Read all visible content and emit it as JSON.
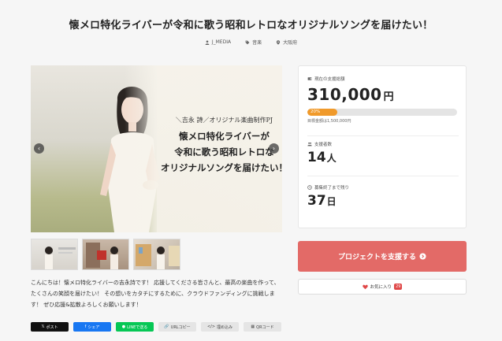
{
  "project": {
    "title": "懐メロ特化ライバーが令和に歌う昭和レトロなオリジナルソングを届けたい！",
    "meta": [
      {
        "icon": "user-icon",
        "text": "J_MEDIA"
      },
      {
        "icon": "tag-icon",
        "text": "音楽"
      },
      {
        "icon": "location-icon",
        "text": "大阪府"
      }
    ]
  },
  "hero": {
    "caption_sub": "＼吉永 詩／オリジナル楽曲制作PJ",
    "caption_lines": [
      "懐メロ特化ライバーが",
      "令和に歌う昭和レトロな",
      "オリジナルソングを届けたい！"
    ],
    "prev_arrow": "‹",
    "next_arrow": "›"
  },
  "description": "こんにちは！懐メロ特化ライバーの吉永詩です！ 応援してくださる皆さんと、最高の楽曲を作って、たくさんの笑顔を届けたい！ その想いをカタチにするために、クラウドファンディングに挑戦します！ ぜひ応援&拡散よろしくお願いします！",
  "share": [
    {
      "name": "x-post",
      "label": "ポスト",
      "icon": "𝕏"
    },
    {
      "name": "facebook-share",
      "label": "シェア",
      "icon": "f"
    },
    {
      "name": "line-send",
      "label": "LINEで送る",
      "icon": "●"
    },
    {
      "name": "url-copy",
      "label": "URLコピー",
      "icon": "🔗"
    },
    {
      "name": "embed",
      "label": "埋め込み",
      "icon": "</>"
    },
    {
      "name": "qr-code",
      "label": "QRコード",
      "icon": "▦"
    }
  ],
  "stats": {
    "total_label": "現在の支援総額",
    "total_amount": "310,000",
    "total_unit": "円",
    "progress_percent": 20,
    "progress_label": "20%",
    "goal_text": "目標金額は1,500,000円",
    "supporters_label": "支援者数",
    "supporters_value": "14",
    "supporters_unit": "人",
    "remaining_label": "募集終了まで残り",
    "remaining_value": "37",
    "remaining_unit": "日"
  },
  "actions": {
    "support_label": "プロジェクトを支援する",
    "favorite_label": "お気に入り",
    "favorite_count": "29"
  },
  "colors": {
    "support_button": "#e36a67",
    "progress_fill": "#f09a2b",
    "favorite_badge": "#e04848"
  }
}
